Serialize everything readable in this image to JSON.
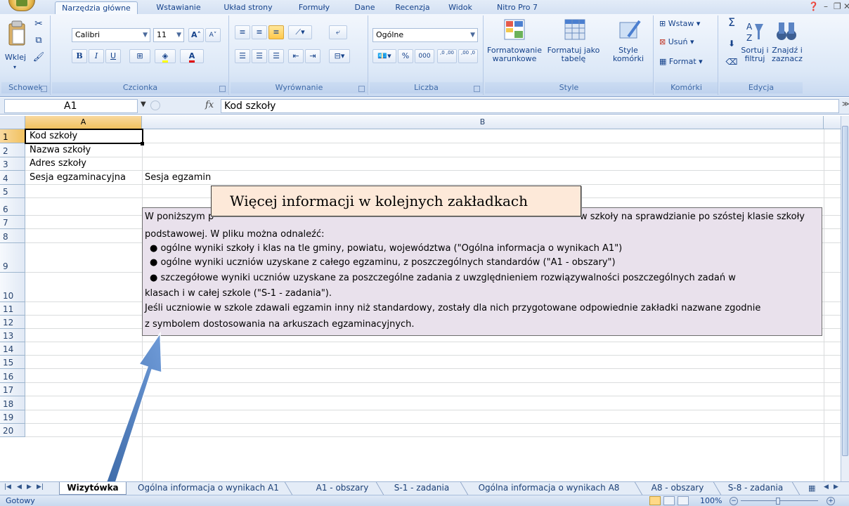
{
  "ribbon_tabs": [
    "Narzędzia główne",
    "Wstawianie",
    "Układ strony",
    "Formuły",
    "Dane",
    "Recenzja",
    "Widok",
    "Nitro Pro 7"
  ],
  "clipboard": {
    "paste_label": "Wklej",
    "group_label": "Schowek"
  },
  "font": {
    "name": "Calibri",
    "size": "11",
    "bold": "B",
    "italic": "I",
    "underline": "U",
    "group_label": "Czcionka"
  },
  "alignment": {
    "group_label": "Wyrównanie"
  },
  "number": {
    "format": "Ogólne",
    "percent": "%",
    "thousands": "000",
    "inc_decimal": ",0 ,00",
    "dec_decimal": ",00 ,0",
    "group_label": "Liczba"
  },
  "styles": {
    "conditional_label": "Formatowanie warunkowe",
    "table_label": "Formatuj jako tabelę",
    "cell_styles_label": "Style komórki",
    "group_label": "Style"
  },
  "cells": {
    "insert_label": "Wstaw",
    "delete_label": "Usuń",
    "format_label": "Format",
    "group_label": "Komórki"
  },
  "editing": {
    "sum_symbol": "Σ",
    "sort_label": "Sortuj i filtruj",
    "find_label": "Znajdź i zaznacz",
    "group_label": "Edycja"
  },
  "formula_bar": {
    "name_box": "A1",
    "fx": "fx",
    "content": "Kod szkoły"
  },
  "columns": [
    "A",
    "B"
  ],
  "rows": [
    "1",
    "2",
    "3",
    "4",
    "5",
    "6",
    "7",
    "8",
    "9",
    "10",
    "11",
    "12",
    "13",
    "14",
    "15",
    "16",
    "17",
    "18",
    "19",
    "20"
  ],
  "cell_values": {
    "A1": "Kod szkoły",
    "A2": "Nazwa szkoły",
    "A3": "Adres szkoły",
    "A4": "Sesja egzaminacyjna",
    "B4": "Sesja egzamin"
  },
  "info_box": {
    "line1": "W poniższym p",
    "line1b": "w szkoły na sprawdzianie po szóstej klasie szkoły",
    "line2": "podstawowej. W pliku można odnaleźć:",
    "bullet1": "●  ogólne wyniki szkoły i klas na tle gminy, powiatu, województwa (\"Ogólna informacja o wynikach A1\")",
    "bullet2": "●  ogólne wyniki uczniów uzyskane z całego egzaminu, z poszczególnych standardów (\"A1 - obszary\")",
    "bullet3": "●  szczegółowe wyniki uczniów uzyskane za poszczególne zadania z uwzględnieniem rozwiązywalności poszczególnych zadań w",
    "bullet3b": "klasach i w całej szkole (\"S-1 - zadania\").",
    "para1": "Jeśli uczniowie w szkole zdawali egzamin inny niż standardowy, zostały dla nich przygotowane odpowiednie zakładki nazwane zgodnie",
    "para2": "z symbolem dostosowania na arkuszach egzaminacyjnych."
  },
  "callout": "Więcej informacji w kolejnych zakładkach",
  "sheet_tabs": [
    "Wizytówka",
    "Ogólna informacja o wynikach A1",
    "A1 - obszary",
    "S-1 - zadania",
    "Ogólna informacja o wynikach A8",
    "A8 - obszary",
    "S-8 - zadania"
  ],
  "status": {
    "ready": "Gotowy",
    "zoom": "100%"
  },
  "colors": {
    "callout_bg": "#fde9d9",
    "info_bg": "#e9e1ec",
    "arrow": "#4f81bd",
    "selection_header": "#f1c15f"
  }
}
